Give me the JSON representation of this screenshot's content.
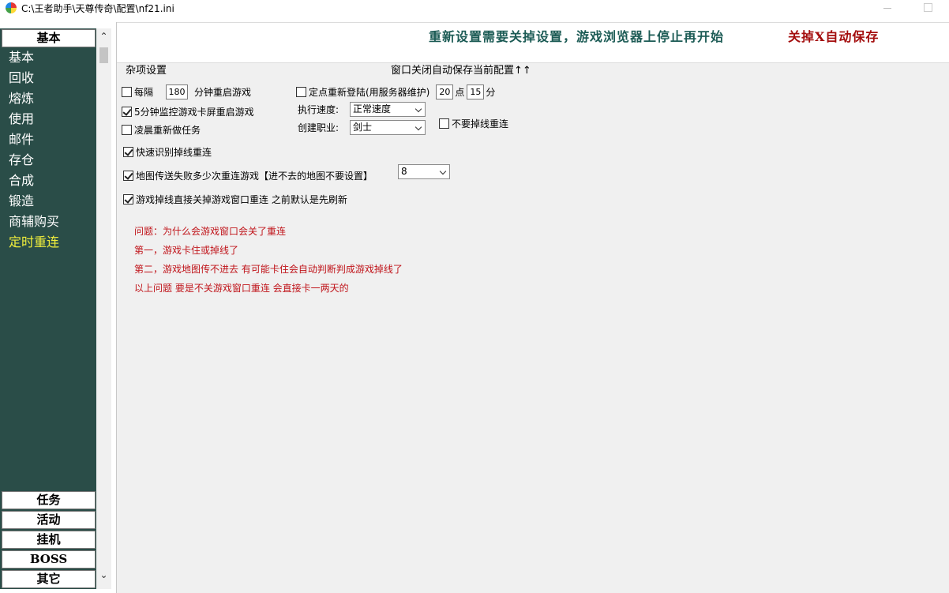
{
  "window": {
    "title": "C:\\王者助手\\天尊传奇\\配置\\nf21.ini"
  },
  "sidebar": {
    "top_button": "基本",
    "items": [
      "基本",
      "回收",
      "熔炼",
      "使用",
      "邮件",
      "存仓",
      "合成",
      "锻造",
      "商辅购买",
      "定时重连"
    ],
    "active_item": "定时重连",
    "bottom_buttons": [
      "任务",
      "活动",
      "挂机",
      "BOSS",
      "其它"
    ]
  },
  "banner": {
    "notice": "重新设置需要关掉设置，游戏浏览器上停止再开始",
    "save": "关掉X自动保存"
  },
  "settings": {
    "section_title": "杂项设置",
    "autosave_note": "窗口关闭自动保存当前配置↑↑",
    "restart_every": {
      "label_before": "每隔",
      "value": "180",
      "label_after": "分钟重启游戏",
      "checked": false
    },
    "monitor_stuck": {
      "label": "5分钟监控游戏卡屏重启游戏",
      "checked": true
    },
    "redo_tasks_morning": {
      "label": "凌晨重新做任务",
      "checked": false
    },
    "fast_detect_disconnect": {
      "label": "快速识别掉线重连",
      "checked": true
    },
    "map_teleport_fail": {
      "label": "地图传送失败多少次重连游戏【进不去的地图不要设置】",
      "checked": true,
      "value": "8"
    },
    "close_window_on_disconnect": {
      "label": "游戏掉线直接关掉游戏窗口重连 之前默认是先刷新",
      "checked": true
    },
    "scheduled_relogin": {
      "label": "定点重新登陆(用服务器维护)",
      "checked": false,
      "hour": "20",
      "hour_unit": "点",
      "minute": "15",
      "minute_unit": "分"
    },
    "exec_speed": {
      "label": "执行速度:",
      "value": "正常速度"
    },
    "create_class": {
      "label": "创建职业:",
      "value": "剑士"
    },
    "no_disconnect_reconnect": {
      "label": "不要掉线重连",
      "checked": false
    }
  },
  "faq": [
    "问题：为什么会游戏窗口会关了重连",
    "第一，游戏卡住或掉线了",
    "第二，游戏地图传不进去 有可能卡住会自动判断判成游戏掉线了",
    "以上问题 要是不关游戏窗口重连 会直接卡一两天的"
  ]
}
